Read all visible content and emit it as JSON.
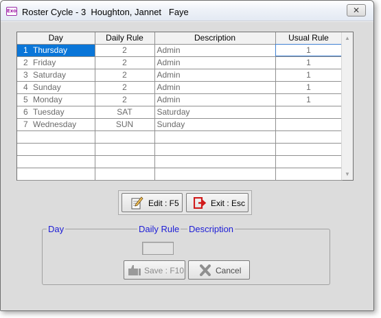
{
  "window": {
    "app_icon_text": "Exo",
    "title": "Roster Cycle - 3  Houghton, Jannet   Faye",
    "close_glyph": "✕"
  },
  "grid": {
    "headers": [
      "Day",
      "Daily Rule",
      "Description",
      "Usual Rule"
    ],
    "rows": [
      {
        "num": "1",
        "day": "Thursday",
        "rule": "2",
        "desc": "Admin",
        "usual": "1",
        "selected": true
      },
      {
        "num": "2",
        "day": "Friday",
        "rule": "2",
        "desc": "Admin",
        "usual": "1",
        "selected": false
      },
      {
        "num": "3",
        "day": "Saturday",
        "rule": "2",
        "desc": "Admin",
        "usual": "1",
        "selected": false
      },
      {
        "num": "4",
        "day": "Sunday",
        "rule": "2",
        "desc": "Admin",
        "usual": "1",
        "selected": false
      },
      {
        "num": "5",
        "day": "Monday",
        "rule": "2",
        "desc": "Admin",
        "usual": "1",
        "selected": false
      },
      {
        "num": "6",
        "day": "Tuesday",
        "rule": "SAT",
        "desc": "Saturday",
        "usual": "",
        "selected": false
      },
      {
        "num": "7",
        "day": "Wednesday",
        "rule": "SUN",
        "desc": "Sunday",
        "usual": "",
        "selected": false
      },
      {
        "num": "",
        "day": "",
        "rule": "",
        "desc": "",
        "usual": "",
        "selected": false
      },
      {
        "num": "",
        "day": "",
        "rule": "",
        "desc": "",
        "usual": "",
        "selected": false
      },
      {
        "num": "",
        "day": "",
        "rule": "",
        "desc": "",
        "usual": "",
        "selected": false
      },
      {
        "num": "",
        "day": "",
        "rule": "",
        "desc": "",
        "usual": "",
        "selected": false
      }
    ],
    "scroll_up_glyph": "▲",
    "scroll_down_glyph": "▼"
  },
  "buttons": {
    "edit": "Edit : F5",
    "exit": "Exit : Esc",
    "edit_icon": "edit-icon",
    "exit_icon": "exit-icon"
  },
  "edit_panel": {
    "legend_day": "Day",
    "legend_rule": "Daily Rule",
    "legend_desc": "Description",
    "rule_value": "",
    "save": "Save : F10",
    "cancel": "Cancel",
    "save_icon": "save-icon",
    "cancel_icon": "cancel-icon"
  },
  "colors": {
    "selection": "#0a76d8",
    "legend_text": "#1c1cd6",
    "exit_icon_red": "#d11a1a"
  }
}
